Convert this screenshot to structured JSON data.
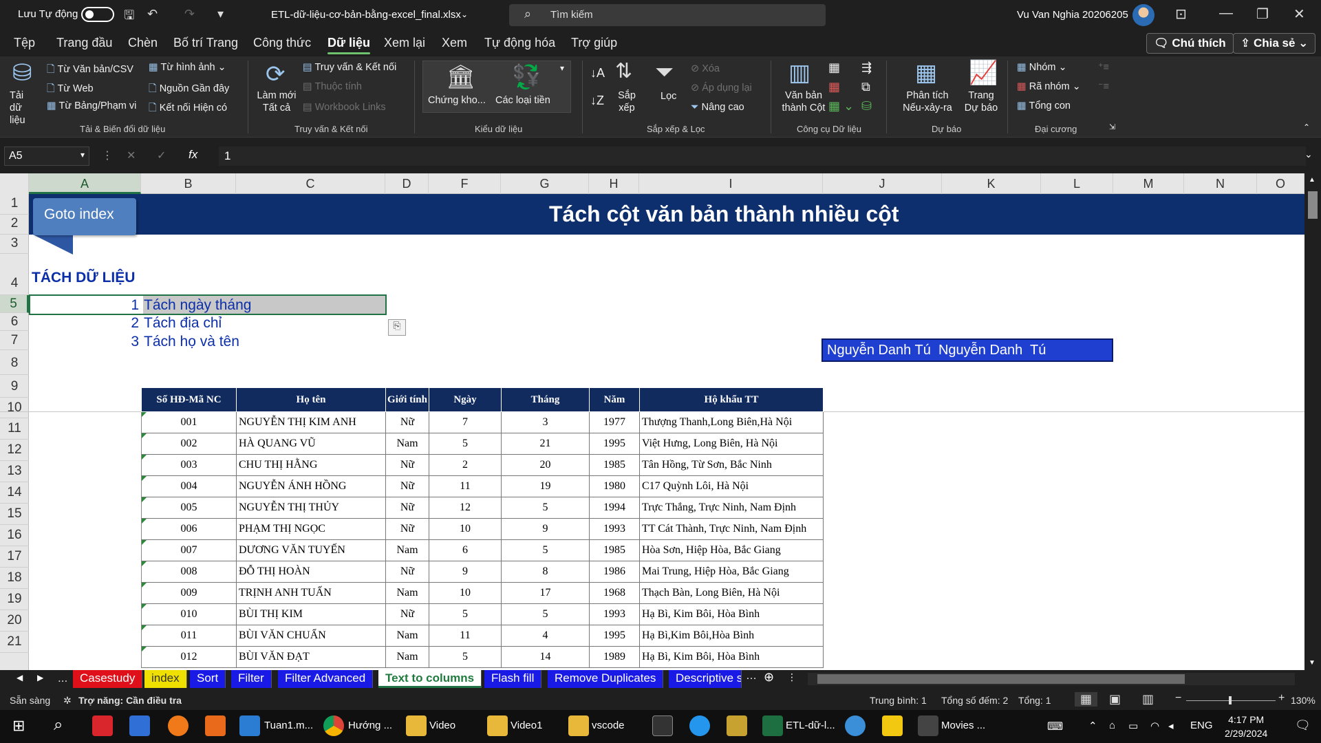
{
  "titlebar": {
    "autosave": "Lưu Tự động",
    "filename": "ETL-dữ-liệu-cơ-bản-bằng-excel_final.xlsx",
    "search": "Tìm kiếm",
    "user": "Vu Van Nghia 20206205"
  },
  "menu": {
    "tabs": [
      "Tệp",
      "Trang đầu",
      "Chèn",
      "Bố trí Trang",
      "Công thức",
      "Dữ liệu",
      "Xem lại",
      "Xem",
      "Tự động hóa",
      "Trợ giúp"
    ],
    "comments": "Chú thích",
    "share": "Chia sẻ"
  },
  "ribbon": {
    "get_data": "Tải dữ liệu",
    "from_text": "Từ Văn bản/CSV",
    "from_web": "Từ Web",
    "from_table": "Từ Bảng/Phạm vi",
    "from_image": "Từ hình ảnh",
    "recent": "Nguồn Gần đây",
    "existing": "Kết nối Hiện có",
    "group1": "Tải & Biến đổi dữ liệu",
    "refresh_all": "Làm mới Tất cả",
    "queries": "Truy vấn & Kết nối",
    "properties": "Thuộc tính",
    "workbook_links": "Workbook Links",
    "group2": "Truy vấn & Kết nối",
    "stocks": "Chứng kho...",
    "currencies": "Các loại tiền",
    "group3": "Kiểu dữ liệu",
    "sort": "Sắp xếp",
    "filter": "Lọc",
    "clear": "Xóa",
    "reapply": "Áp dụng lại",
    "advanced": "Nâng cao",
    "group4": "Sắp xếp & Lọc",
    "text_to_cols": "Văn bản thành Cột",
    "group5": "Công cụ Dữ liệu",
    "whatif": "Phân tích Nếu-xảy-ra",
    "forecast": "Trang Dự báo",
    "group6": "Dự báo",
    "group_btn": "Nhóm",
    "ungroup": "Rã nhóm",
    "subtotal": "Tổng con",
    "group7": "Đại cương"
  },
  "formula_bar": {
    "cell_ref": "A5",
    "fx": "fx",
    "value": "1"
  },
  "columns": [
    "A",
    "B",
    "C",
    "D",
    "F",
    "G",
    "H",
    "I",
    "J",
    "K",
    "L",
    "M",
    "N",
    "O"
  ],
  "rows": [
    "1",
    "2",
    "3",
    "4",
    "5",
    "6",
    "7",
    "8",
    "9",
    "10",
    "11",
    "12",
    "13",
    "14",
    "15",
    "16",
    "17",
    "18",
    "19",
    "20",
    "21"
  ],
  "sheet": {
    "goto": "Goto index",
    "banner_title": "Tách cột văn bản thành nhiều cột",
    "section": "TÁCH DỮ LIỆU",
    "list": [
      {
        "n": "1",
        "t": "Tách ngày tháng"
      },
      {
        "n": "2",
        "t": "Tách địa chỉ"
      },
      {
        "n": "3",
        "t": "Tách họ và tên"
      }
    ],
    "name_cell": "Nguyễn Danh Tú  Nguyễn Danh  Tú"
  },
  "table": {
    "headers": [
      "Số HĐ-Mã NC",
      "Họ tên",
      "Giới tính",
      "Ngày",
      "Tháng",
      "Năm",
      "Hộ khẩu TT"
    ],
    "rows": [
      [
        "001",
        "NGUYỄN THỊ KIM ANH",
        "Nữ",
        "7",
        "3",
        "1977",
        "Thượng Thanh,Long Biên,Hà Nội"
      ],
      [
        "002",
        "HÀ QUANG VŨ",
        "Nam",
        "5",
        "21",
        "1995",
        "Việt Hưng, Long Biên, Hà Nội"
      ],
      [
        "003",
        "CHU THỊ HẰNG",
        "Nữ",
        "2",
        "20",
        "1985",
        "Tân Hồng, Từ Sơn, Bắc Ninh"
      ],
      [
        "004",
        "NGUYỄN ÁNH HỒNG",
        "Nữ",
        "11",
        "19",
        "1980",
        "C17 Quỳnh Lôi, Hà Nội"
      ],
      [
        "005",
        "NGUYỄN THỊ THỦY",
        "Nữ",
        "12",
        "5",
        "1994",
        "Trực Thắng, Trực Ninh, Nam Định"
      ],
      [
        "006",
        "PHẠM THỊ NGỌC",
        "Nữ",
        "10",
        "9",
        "1993",
        "TT Cát Thành, Trực Ninh, Nam Định"
      ],
      [
        "007",
        "DƯƠNG VĂN TUYẾN",
        "Nam",
        "6",
        "5",
        "1985",
        "Hòa Sơn, Hiệp Hòa, Bắc Giang"
      ],
      [
        "008",
        "ĐỖ THỊ HOÀN",
        "Nữ",
        "9",
        "8",
        "1986",
        "Mai Trung, Hiệp Hòa, Bắc Giang"
      ],
      [
        "009",
        "TRỊNH ANH TUẤN",
        "Nam",
        "10",
        "17",
        "1968",
        "Thạch Bàn, Long Biên, Hà Nội"
      ],
      [
        "010",
        "BÙI THỊ KIM",
        "Nữ",
        "5",
        "5",
        "1993",
        "Hạ Bì, Kim Bôi, Hòa Bình"
      ],
      [
        "011",
        "BÙI VĂN CHUẨN",
        "Nam",
        "11",
        "4",
        "1995",
        "Hạ Bì,Kim Bôi,Hòa Bình"
      ],
      [
        "012",
        "BÙI VĂN ĐẠT",
        "Nam",
        "5",
        "14",
        "1989",
        "Hạ Bì, Kim Bôi, Hòa Bình"
      ]
    ]
  },
  "sheet_tabs": [
    "...",
    "Casestudy",
    "index",
    "Sort",
    "Filter",
    "Filter Advanced",
    "Text to columns",
    "Flash fill",
    "Remove Duplicates",
    "Descriptive s"
  ],
  "status": {
    "ready": "Sẵn sàng",
    "accessibility": "Trợ năng: Cần điều tra",
    "average": "Trung bình: 1",
    "count": "Tổng số đếm: 2",
    "sum": "Tổng: 1",
    "zoom": "130%"
  },
  "taskbar": {
    "apps": [
      "Tuan1.m...",
      "Hướng ...",
      "Video",
      "Video1",
      "vscode",
      "ETL-dữ-l...",
      "Movies ..."
    ],
    "lang": "ENG",
    "time": "4:17 PM",
    "date": "2/29/2024"
  }
}
